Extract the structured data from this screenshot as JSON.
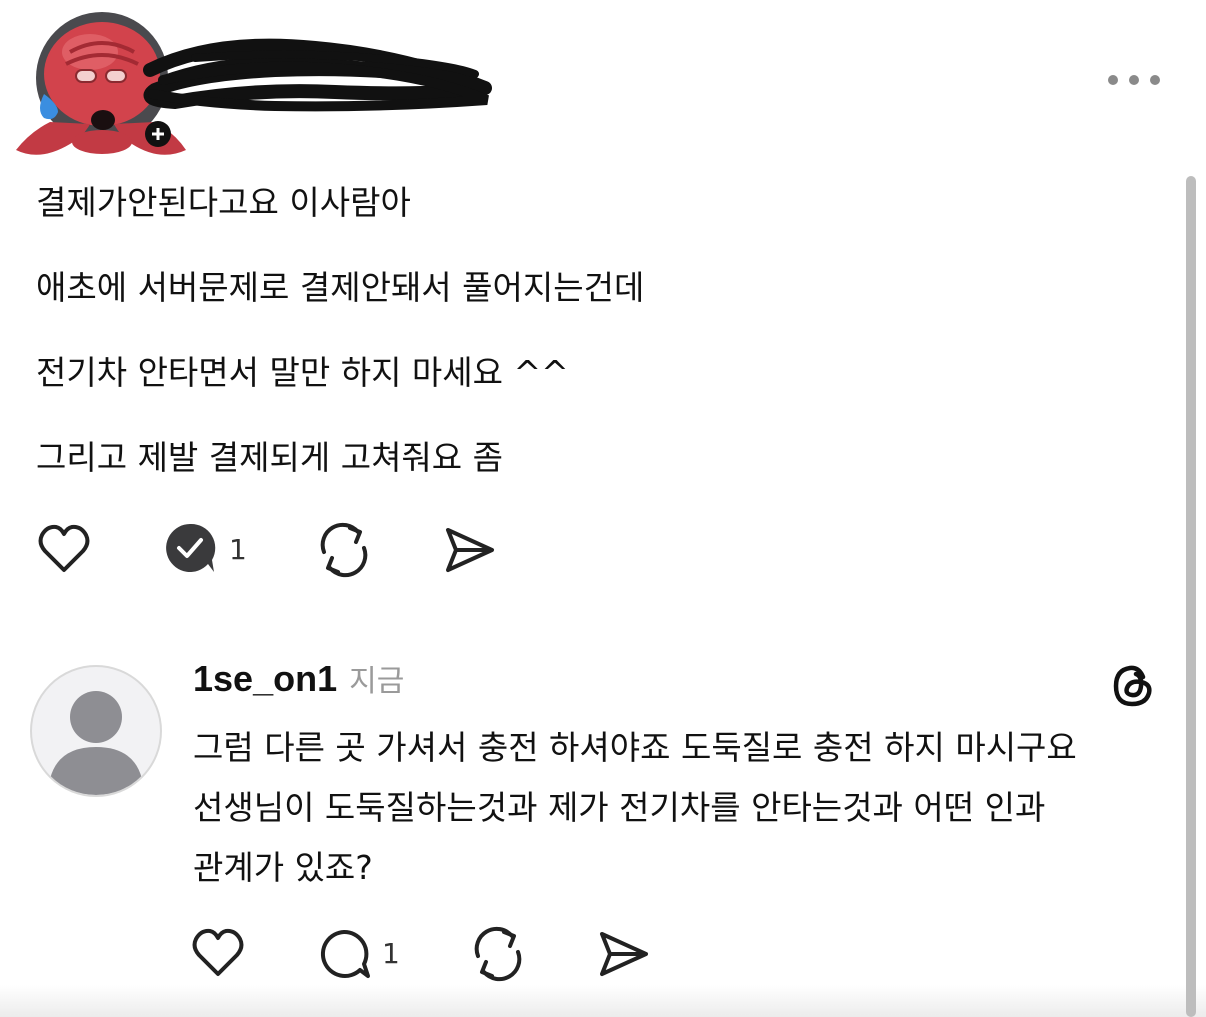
{
  "post": {
    "author_name": "[redacted]",
    "author_name_obscured": true,
    "lines": [
      "결제가안된다고요 이사람아",
      "애초에 서버문제로 결제안돼서 풀어지는건데",
      "전기차 안타면서 말만 하지 마세요 ^^",
      "그리고 제발 결제되게 고쳐줘요 좀"
    ],
    "actions": {
      "like_icon": "heart-icon",
      "reply_icon": "reply-replied-icon",
      "reply_count": "1",
      "repost_icon": "repost-icon",
      "share_icon": "send-icon"
    },
    "more_icon": "more-horizontal-icon"
  },
  "reply": {
    "username": "1se_on1",
    "time": "지금",
    "app_icon": "threads-logo-icon",
    "lines": [
      "그럼 다른 곳 가셔서 충전 하셔야죠 도둑질로 충전 하지 마시구요",
      "선생님이 도둑질하는것과 제가 전기차를 안타는것과 어떤 인과",
      "관계가 있죠?"
    ],
    "actions": {
      "like_icon": "heart-icon",
      "reply_icon": "comment-icon",
      "reply_count": "1",
      "repost_icon": "repost-icon",
      "share_icon": "send-icon"
    }
  },
  "colors": {
    "text": "#111111",
    "muted": "#9a9a9a",
    "icon": "#333333",
    "avatar_red": "#c8404a",
    "avatar_default_bg": "#f2f2f4",
    "avatar_default_fg": "#8e8e93"
  }
}
